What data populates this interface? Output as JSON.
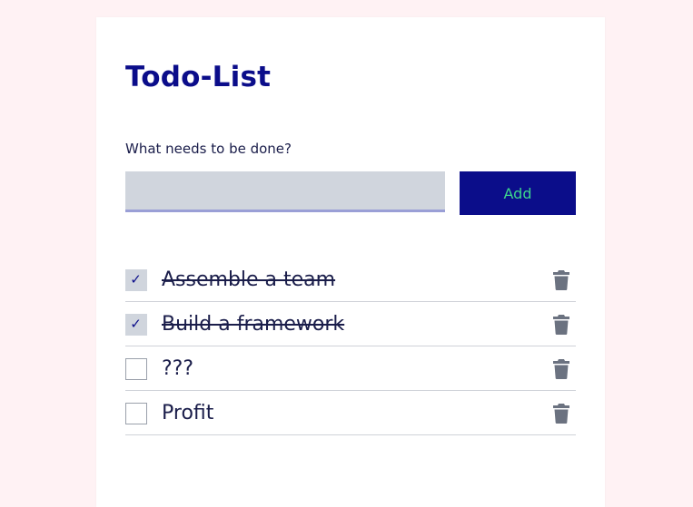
{
  "app": {
    "title": "Todo-List"
  },
  "form": {
    "label": "What needs to be done?",
    "input_value": "",
    "input_placeholder": "",
    "add_label": "Add"
  },
  "todos": [
    {
      "text": "Assemble a team",
      "done": true
    },
    {
      "text": "Build a framework",
      "done": true
    },
    {
      "text": "???",
      "done": false
    },
    {
      "text": "Profit",
      "done": false
    }
  ],
  "icons": {
    "check": "check-icon",
    "delete": "trash-icon"
  },
  "colors": {
    "background": "#fff2f4",
    "card": "#ffffff",
    "title": "#0b0d8a",
    "button_bg": "#0b0d8a",
    "button_text": "#3dd68c",
    "input_bg": "#d0d5dd",
    "input_underline": "#9a9fd6",
    "icon": "#6b7280"
  }
}
